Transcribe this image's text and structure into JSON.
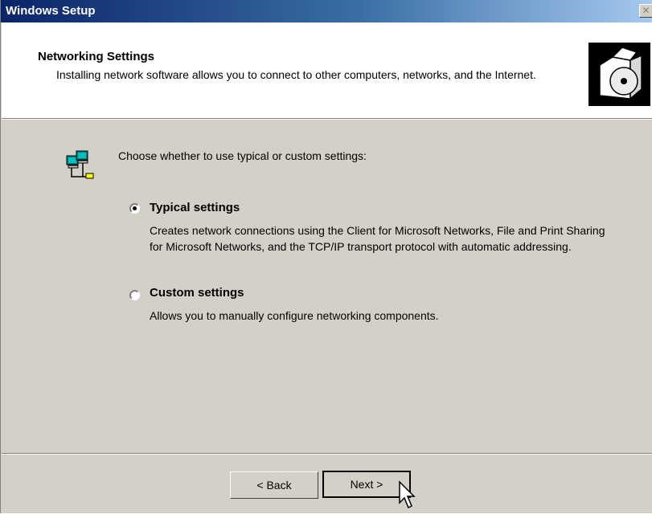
{
  "window": {
    "title": "Windows Setup",
    "close_label": "✕"
  },
  "header": {
    "title": "Networking Settings",
    "subtitle": "Installing network software allows you to connect to other computers, networks, and the Internet."
  },
  "body": {
    "prompt": "Choose whether to use typical or custom settings:",
    "options": [
      {
        "label": "Typical settings",
        "selected": true,
        "description": "Creates network connections using the Client for Microsoft Networks, File and Print Sharing for Microsoft Networks, and the TCP/IP transport protocol with automatic addressing."
      },
      {
        "label": "Custom settings",
        "selected": false,
        "description": "Allows you to manually configure networking components."
      }
    ]
  },
  "buttons": {
    "back_label": "< Back",
    "next_label": "Next >"
  },
  "icons": {
    "header": "setup-disc-icon",
    "network": "network-computers-icon",
    "close": "close-icon",
    "cursor": "mouse-cursor-icon"
  },
  "colors": {
    "titlebar_start": "#0a246a",
    "titlebar_end": "#a6caf0",
    "dialog_bg": "#d4d0c8"
  }
}
